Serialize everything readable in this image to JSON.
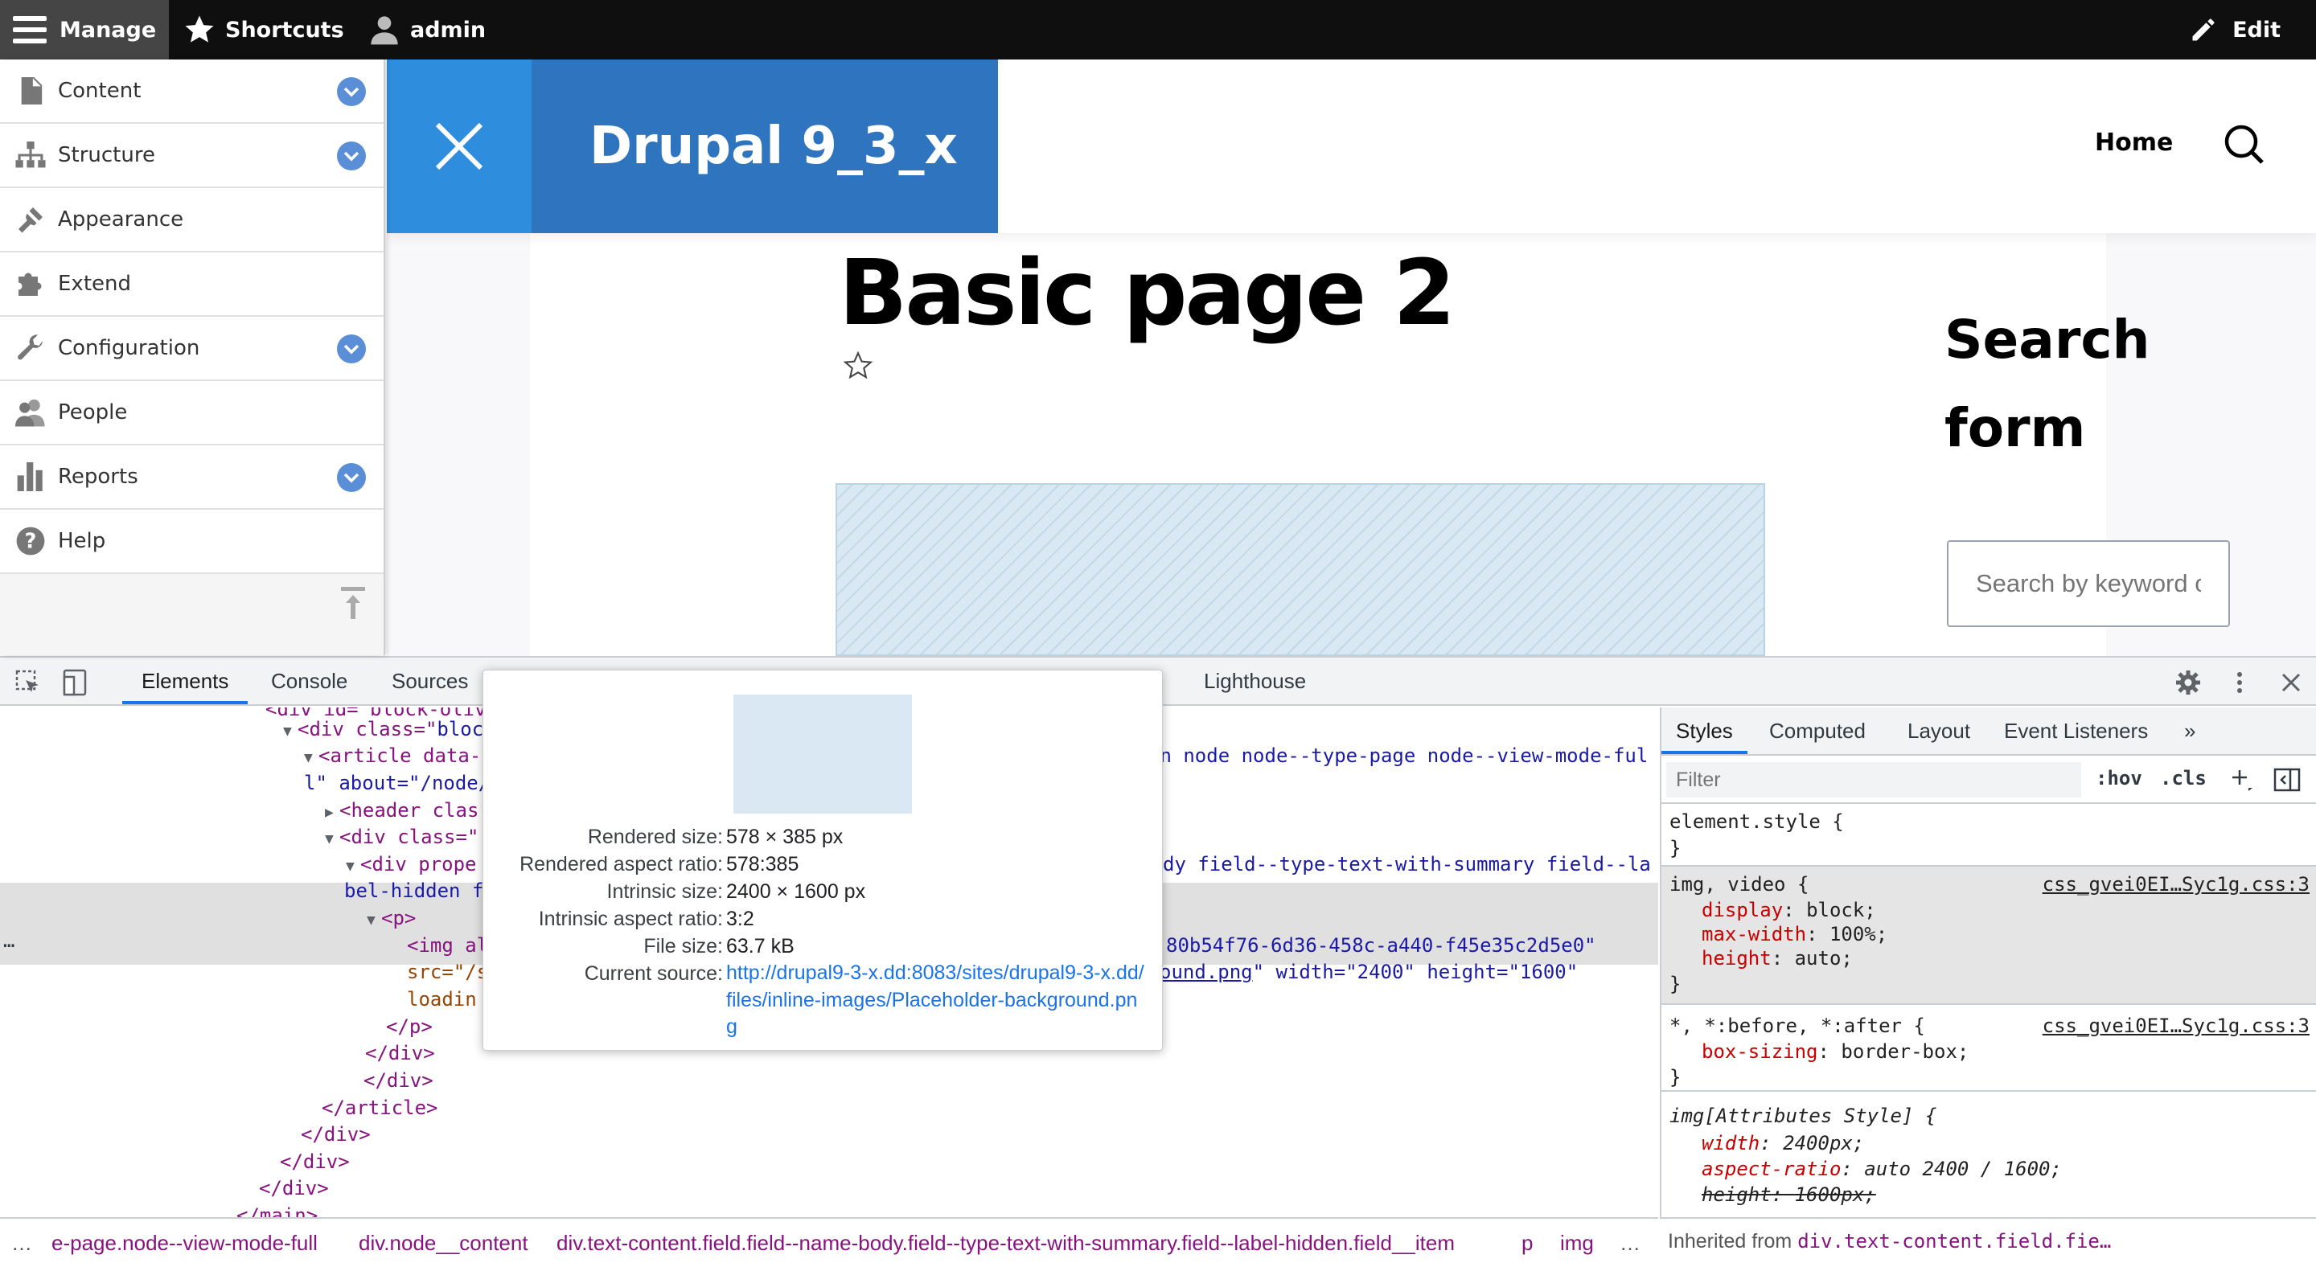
{
  "toolbar": {
    "manage": "Manage",
    "shortcuts": "Shortcuts",
    "user": "admin",
    "edit": "Edit"
  },
  "admin_menu": [
    {
      "label": "Content",
      "icon": "file-icon",
      "has_children": true
    },
    {
      "label": "Structure",
      "icon": "sitemap-icon",
      "has_children": true
    },
    {
      "label": "Appearance",
      "icon": "paintbrush-icon",
      "has_children": false
    },
    {
      "label": "Extend",
      "icon": "puzzle-icon",
      "has_children": false
    },
    {
      "label": "Configuration",
      "icon": "wrench-icon",
      "has_children": true
    },
    {
      "label": "People",
      "icon": "people-icon",
      "has_children": false
    },
    {
      "label": "Reports",
      "icon": "bar-chart-icon",
      "has_children": true
    },
    {
      "label": "Help",
      "icon": "help-icon",
      "has_children": false
    }
  ],
  "site": {
    "name": "Drupal 9_3_x",
    "nav_home": "Home",
    "page_title": "Basic page 2",
    "sidebar_title": "Search form",
    "search_placeholder": "Search by keyword or phrase."
  },
  "devtools": {
    "tabs": [
      "Elements",
      "Console",
      "Sources",
      "Lighthouse"
    ],
    "active_tab": "Elements",
    "dom_lines": {
      "l0": "<div id=\"block-olivero-content\" class=\"block\">",
      "l1a": "<div class=\"",
      "l1b": "bloc",
      "l2a": "<article data-",
      "l2b": "on node node--type-page node--view-mode-ful",
      "l3a": "l\" about=\"/node/",
      "l4a": "<header clas",
      "l5a": "<div class=\"",
      "l6a": "<div prope",
      "l6b": "dy field--type-text-with-summary field--la",
      "l7a": "bel-hidden f",
      "l8a": "<p>",
      "l9a": "<img al",
      "l9b": "80b54f76-6d36-458c-a440-f45e35c2d5e0\"",
      "l10a": "src=\"/s",
      "l10b": "ound.png",
      "l10c": "\" width=\"2400\" height=\"1600\"",
      "l11a": "loadin",
      "l12": "</p>",
      "l13": "</div>",
      "l14": "</div>",
      "l15": "</article>",
      "l16": "</div>",
      "l17": "</div>",
      "l18": "</div>",
      "l19": "</main>"
    },
    "tooltip": {
      "rendered_size_label": "Rendered size:",
      "rendered_size": "578 × 385 px",
      "rendered_ratio_label": "Rendered aspect ratio:",
      "rendered_ratio": "578:385",
      "intrinsic_size_label": "Intrinsic size:",
      "intrinsic_size": "2400 × 1600 px",
      "intrinsic_ratio_label": "Intrinsic aspect ratio:",
      "intrinsic_ratio": "3:2",
      "file_size_label": "File size:",
      "file_size": "63.7 kB",
      "current_source_label": "Current source:",
      "current_source": "http://drupal9-3-x.dd:8083/sites/drupal9-3-x.dd/files/inline-images/Placeholder-background.png"
    },
    "styles_tabs": [
      "Styles",
      "Computed",
      "Layout",
      "Event Listeners",
      "»"
    ],
    "filter_placeholder": "Filter",
    "filter_hov": ":hov",
    "filter_cls": ".cls",
    "rules": {
      "element_style_open": "element.style {",
      "close": "}",
      "img_video_selector": "img, video {",
      "img_video_source": "css_gvei0EI…Syc1g.css:3",
      "display_prop": "display",
      "display_val": "block;",
      "maxw_prop": "max-width",
      "maxw_val": "100%;",
      "height_prop": "height",
      "height_val": "auto;",
      "star_selector": "*, *:before, *:after {",
      "star_source": "css_gvei0EI…Syc1g.css:3",
      "boxsizing_prop": "box-sizing",
      "boxsizing_val": "border-box;",
      "attr_selector": "img[Attributes Style] {",
      "attr_width_prop": "width",
      "attr_width_val": "2400px;",
      "attr_ratio_prop": "aspect-ratio",
      "attr_ratio_val": "auto 2400 / 1600;",
      "attr_height_prop": "height",
      "attr_height_val": "1600px;"
    },
    "inherited_label": "Inherited from",
    "inherited_from": "div.text-content.field.fie…",
    "breadcrumbs": [
      "e-page.node--view-mode-full",
      "div.node__content",
      "div.text-content.field.field--name-body.field--type-text-with-summary.field--label-hidden.field__item",
      "p",
      "img"
    ],
    "ellipsis": "…"
  }
}
